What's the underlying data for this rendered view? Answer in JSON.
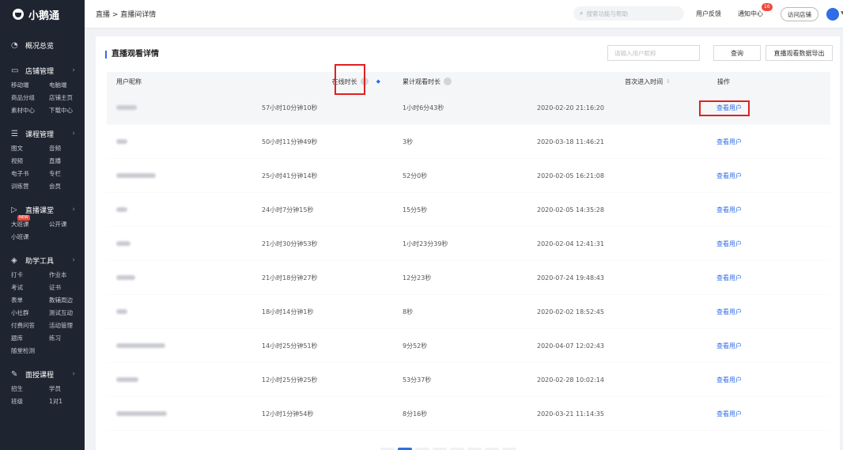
{
  "app": {
    "name": "小鹅通"
  },
  "sidebar": {
    "overview": "概况总览",
    "groups": [
      {
        "title": "店铺管理",
        "icon": "store-icon",
        "items": [
          "移动端",
          "电脑端",
          "商品分组",
          "店铺主页",
          "素材中心",
          "下载中心"
        ]
      },
      {
        "title": "课程管理",
        "icon": "course-icon",
        "items": [
          "图文",
          "音频",
          "视频",
          "直播",
          "电子书",
          "专栏",
          "训练营",
          "会员"
        ]
      },
      {
        "title": "直播课堂",
        "icon": "live-icon",
        "items": [
          "大班课",
          "公开课",
          "小班课"
        ],
        "new_badge": "NEW"
      },
      {
        "title": "助学工具",
        "icon": "tools-icon",
        "items": [
          "打卡",
          "作业本",
          "考试",
          "证书",
          "表单",
          "教辅周边",
          "小社群",
          "测试互动",
          "付费问答",
          "活动管理",
          "题库",
          "练习",
          "随堂检测"
        ]
      },
      {
        "title": "面授课程",
        "icon": "offline-course-icon",
        "items": [
          "招生",
          "学员",
          "班级",
          "1对1"
        ]
      }
    ]
  },
  "topbar": {
    "breadcrumb": "直播 > 直播间详情",
    "search_placeholder": "搜索功能与帮助",
    "feedback": "用户反馈",
    "notice": "通知中心",
    "notice_count": "16",
    "visit_store": "访问店铺"
  },
  "panel": {
    "title": "直播观看详情",
    "search_placeholder": "请输入用户昵称",
    "query_label": "查询",
    "export_label": "直播观看数据导出"
  },
  "table": {
    "headers": {
      "nickname": "用户昵称",
      "online": "在线时长",
      "total": "累计观看时长",
      "first_enter": "首次进入时间",
      "action": "操作"
    },
    "rows": [
      {
        "online": "57小时10分钟10秒",
        "total": "1小时6分43秒",
        "first_enter": "2020-02-20 21:16:20",
        "action": "查看用户"
      },
      {
        "online": "50小时11分钟49秒",
        "total": "3秒",
        "first_enter": "2020-03-18 11:46:21",
        "action": "查看用户"
      },
      {
        "online": "25小时41分钟14秒",
        "total": "52分0秒",
        "first_enter": "2020-02-05 16:21:08",
        "action": "查看用户"
      },
      {
        "online": "24小时7分钟15秒",
        "total": "15分5秒",
        "first_enter": "2020-02-05 14:35:28",
        "action": "查看用户"
      },
      {
        "online": "21小时30分钟53秒",
        "total": "1小时23分39秒",
        "first_enter": "2020-02-04 12:41:31",
        "action": "查看用户"
      },
      {
        "online": "21小时18分钟27秒",
        "total": "12分23秒",
        "first_enter": "2020-07-24 19:48:43",
        "action": "查看用户"
      },
      {
        "online": "18小时14分钟1秒",
        "total": "8秒",
        "first_enter": "2020-02-02 18:52:45",
        "action": "查看用户"
      },
      {
        "online": "14小时25分钟51秒",
        "total": "9分52秒",
        "first_enter": "2020-04-07 12:02:43",
        "action": "查看用户"
      },
      {
        "online": "12小时25分钟25秒",
        "total": "53分37秒",
        "first_enter": "2020-02-28 10:02:14",
        "action": "查看用户"
      },
      {
        "online": "12小时1分钟54秒",
        "total": "8分16秒",
        "first_enter": "2020-03-21 11:14:35",
        "action": "查看用户"
      }
    ]
  }
}
